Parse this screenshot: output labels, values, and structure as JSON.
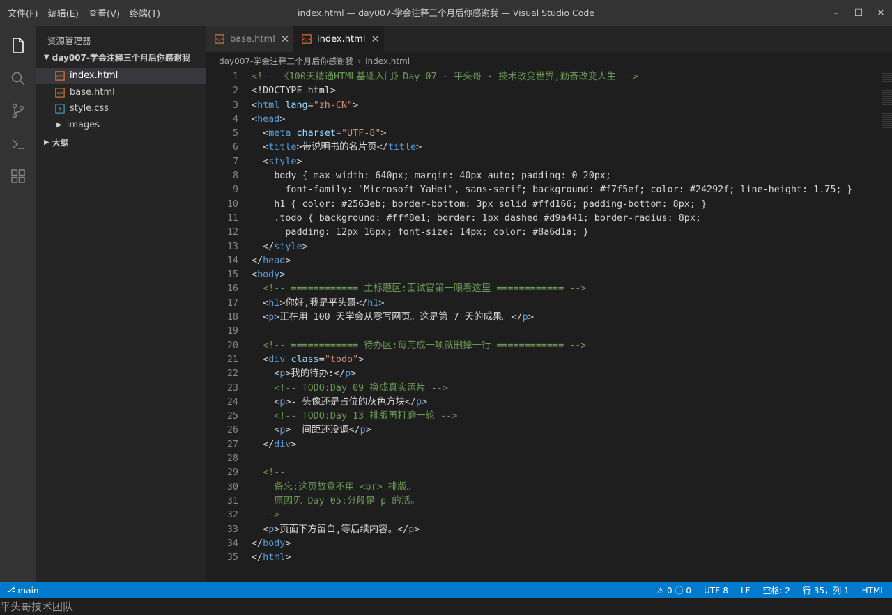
{
  "menu": [
    "文件(F)",
    "编辑(E)",
    "查看(V)",
    "终端(T)"
  ],
  "window_title": "index.html — day007-学会注释三个月后你感谢我 — Visual Studio Code",
  "window_buttons": {
    "minimize": "–",
    "maximize": "☐",
    "close": "✕"
  },
  "activity": [
    "explorer-icon",
    "search-icon",
    "source-control-icon",
    "terminal-icon",
    "extensions-icon"
  ],
  "sidebar": {
    "title": "资源管理器",
    "folder": "day007-学会注释三个月后你感谢我",
    "files": [
      {
        "name": "index.html",
        "type": "html",
        "selected": true
      },
      {
        "name": "base.html",
        "type": "html"
      },
      {
        "name": "style.css",
        "type": "css"
      },
      {
        "name": "images",
        "type": "folder"
      }
    ],
    "outline": "大纲"
  },
  "tabs": [
    {
      "label": "base.html",
      "active": false
    },
    {
      "label": "index.html",
      "active": true
    }
  ],
  "breadcrumb": [
    "day007-学会注释三个月后你感谢我",
    "index.html"
  ],
  "code_lines": [
    [
      [
        "c",
        "<!-- 《100天精通HTML基础入门》Day 07 · 平头哥 · 技术改变世界,勤奋改变人生 -->"
      ]
    ],
    [
      [
        "p",
        "<!DOCTYPE html>"
      ]
    ],
    [
      [
        "p",
        "<"
      ],
      [
        "t",
        "html"
      ],
      [
        "p",
        " "
      ],
      [
        "a",
        "lang"
      ],
      [
        "p",
        "="
      ],
      [
        "s",
        "\"zh-CN\""
      ],
      [
        "p",
        ">"
      ]
    ],
    [
      [
        "p",
        "<"
      ],
      [
        "t",
        "head"
      ],
      [
        "p",
        ">"
      ]
    ],
    [
      [
        "p",
        "  <"
      ],
      [
        "t",
        "meta"
      ],
      [
        "p",
        " "
      ],
      [
        "a",
        "charset"
      ],
      [
        "p",
        "="
      ],
      [
        "s",
        "\"UTF-8\""
      ],
      [
        "p",
        ">"
      ]
    ],
    [
      [
        "p",
        "  <"
      ],
      [
        "t",
        "title"
      ],
      [
        "p",
        ">带说明书的名片页</"
      ],
      [
        "t",
        "title"
      ],
      [
        "p",
        ">"
      ]
    ],
    [
      [
        "p",
        "  <"
      ],
      [
        "t",
        "style"
      ],
      [
        "p",
        ">"
      ]
    ],
    [
      [
        "p",
        "    body { max-width: 640px; margin: 40px auto; padding: 0 20px;"
      ]
    ],
    [
      [
        "p",
        "      font-family: \"Microsoft YaHei\", sans-serif; background: #f7f5ef; color: #24292f; line-height: 1.75; }"
      ]
    ],
    [
      [
        "p",
        "    h1 { color: #2563eb; border-bottom: 3px solid #ffd166; padding-bottom: 8px; }"
      ]
    ],
    [
      [
        "p",
        "    .todo { background: #fff8e1; border: 1px dashed #d9a441; border-radius: 8px;"
      ]
    ],
    [
      [
        "p",
        "      padding: 12px 16px; font-size: 14px; color: #8a6d1a; }"
      ]
    ],
    [
      [
        "p",
        "  </"
      ],
      [
        "t",
        "style"
      ],
      [
        "p",
        ">"
      ]
    ],
    [
      [
        "p",
        "</"
      ],
      [
        "t",
        "head"
      ],
      [
        "p",
        ">"
      ]
    ],
    [
      [
        "p",
        "<"
      ],
      [
        "t",
        "body"
      ],
      [
        "p",
        ">"
      ]
    ],
    [
      [
        "c",
        "  <!-- ============ 主标题区:面试官第一眼看这里 ============ -->"
      ]
    ],
    [
      [
        "p",
        "  <"
      ],
      [
        "t",
        "h1"
      ],
      [
        "p",
        ">你好,我是平头哥</"
      ],
      [
        "t",
        "h1"
      ],
      [
        "p",
        ">"
      ]
    ],
    [
      [
        "p",
        "  <"
      ],
      [
        "t",
        "p"
      ],
      [
        "p",
        ">正在用 100 天学会从零写网页。这是第 7 天的成果。</"
      ],
      [
        "t",
        "p"
      ],
      [
        "p",
        ">"
      ]
    ],
    [
      [
        "p",
        ""
      ]
    ],
    [
      [
        "c",
        "  <!-- ============ 待办区:每完成一项就删掉一行 ============ -->"
      ]
    ],
    [
      [
        "p",
        "  <"
      ],
      [
        "t",
        "div"
      ],
      [
        "p",
        " "
      ],
      [
        "a",
        "class"
      ],
      [
        "p",
        "="
      ],
      [
        "s",
        "\"todo\""
      ],
      [
        "p",
        ">"
      ]
    ],
    [
      [
        "p",
        "    <"
      ],
      [
        "t",
        "p"
      ],
      [
        "p",
        ">我的待办:</"
      ],
      [
        "t",
        "p"
      ],
      [
        "p",
        ">"
      ]
    ],
    [
      [
        "c",
        "    <!-- TODO:Day 09 换成真实照片 -->"
      ]
    ],
    [
      [
        "p",
        "    <"
      ],
      [
        "t",
        "p"
      ],
      [
        "p",
        ">- 头像还是占位的灰色方块</"
      ],
      [
        "t",
        "p"
      ],
      [
        "p",
        ">"
      ]
    ],
    [
      [
        "c",
        "    <!-- TODO:Day 13 排版再打磨一轮 -->"
      ]
    ],
    [
      [
        "p",
        "    <"
      ],
      [
        "t",
        "p"
      ],
      [
        "p",
        ">- 间距还没调</"
      ],
      [
        "t",
        "p"
      ],
      [
        "p",
        ">"
      ]
    ],
    [
      [
        "p",
        "  </"
      ],
      [
        "t",
        "div"
      ],
      [
        "p",
        ">"
      ]
    ],
    [
      [
        "p",
        ""
      ]
    ],
    [
      [
        "c",
        "  <!--"
      ]
    ],
    [
      [
        "c",
        "    备忘:这页故意不用 <br> 排版。"
      ]
    ],
    [
      [
        "c",
        "    原因见 Day 05:分段是 p 的活。"
      ]
    ],
    [
      [
        "c",
        "  -->"
      ]
    ],
    [
      [
        "p",
        "  <"
      ],
      [
        "t",
        "p"
      ],
      [
        "p",
        ">页面下方留白,等后续内容。</"
      ],
      [
        "t",
        "p"
      ],
      [
        "p",
        ">"
      ]
    ],
    [
      [
        "p",
        "</"
      ],
      [
        "t",
        "body"
      ],
      [
        "p",
        ">"
      ]
    ],
    [
      [
        "p",
        "</"
      ],
      [
        "t",
        "html"
      ],
      [
        "p",
        ">"
      ]
    ]
  ],
  "status": {
    "branch": "main",
    "problems": "⚠ 0  ⓘ 0",
    "encoding": "UTF-8",
    "eol": "LF",
    "indent": "空格: 2",
    "position": "行 35，列 1",
    "language": "HTML"
  },
  "watermark": "平头哥技术团队",
  "colors": {
    "accent": "#007acc",
    "comment": "#6a9955",
    "tag": "#569cd6",
    "attr": "#9cdcfe",
    "string": "#ce9178"
  }
}
